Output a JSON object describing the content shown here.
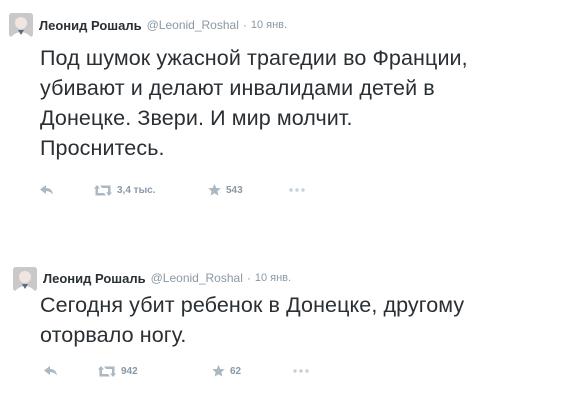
{
  "tweets": [
    {
      "name": "Леонид Рошаль",
      "handle": "@Leonid_Roshal",
      "separator": "·",
      "time": "10 янв.",
      "text_lines": [
        "Под шумок ужасной трагедии во Франции,",
        "убивают и делают инвалидами детей в",
        "Донецке. Звери. И мир молчит.",
        "Проснитесь."
      ],
      "retweets": "3,4 тыс.",
      "favorites": "543",
      "icons": [
        "reply-icon",
        "retweet-icon",
        "favorite-icon",
        "more-icon"
      ]
    },
    {
      "name": "Леонид Рошаль",
      "handle": "@Leonid_Roshal",
      "separator": "·",
      "time": "10 янв.",
      "text_lines": [
        "Сегодня убит ребенок в Донецке, другому",
        "оторвало ногу."
      ],
      "retweets": "942",
      "favorites": "62",
      "icons": [
        "reply-icon",
        "retweet-icon",
        "favorite-icon",
        "more-icon"
      ]
    }
  ],
  "colors": {
    "text": "#292f33",
    "meta": "#8899a6",
    "background": "#ffffff"
  }
}
